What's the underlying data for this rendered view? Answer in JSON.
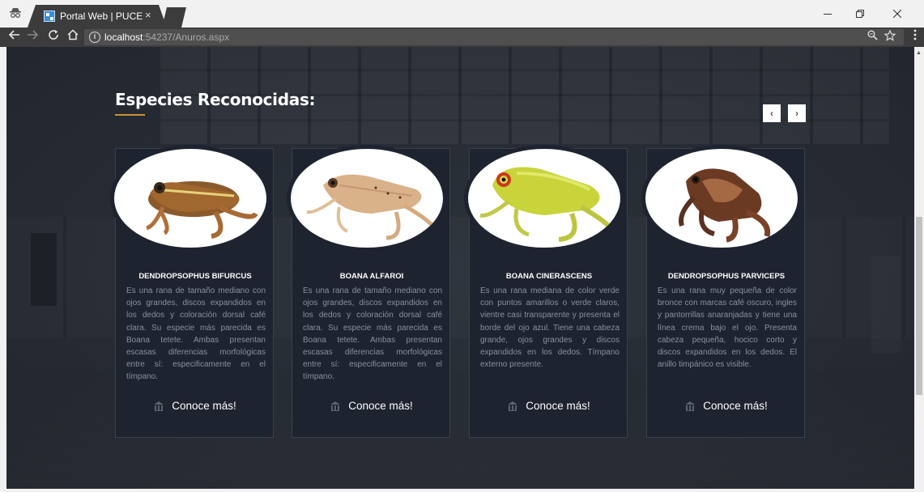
{
  "browser": {
    "tab_title": "Portal Web | PUCE",
    "tab_close": "×",
    "url_host": "localhost",
    "url_rest": ":54237/Anuros.aspx",
    "icons": [
      "incognito-icon",
      "back-icon",
      "forward-icon",
      "reload-icon",
      "home-icon",
      "info-icon",
      "zoom-icon",
      "star-icon",
      "menu-icon",
      "minimize-icon",
      "restore-icon",
      "close-window-icon"
    ]
  },
  "section": {
    "title": "Especies Reconocidas:",
    "prev": "‹",
    "next": "›",
    "accent_color": "#c8922f"
  },
  "cards": [
    {
      "name": "DENDROPSOPHUS BIFURCUS",
      "description": "Es una rana de tamaño mediano con ojos grandes, discos expandidos en los dedos y coloración dorsal café clara. Su especie más parecida es Boana tetete. Ambas presentan escasas diferencias morfológicas entre sí: especificamente en el tímpano.",
      "link": "Conoce más!"
    },
    {
      "name": "BOANA ALFAROI",
      "description": "Es una rana de tamaño mediano con ojos grandes, discos expandidos en los dedos y coloración dorsal café clara. Su especie más parecida es Boana tetete. Ambas presentan escasas diferencias morfológicas entre sí: especificamente en el tímpano.",
      "link": "Conoce más!"
    },
    {
      "name": "BOANA CINERASCENS",
      "description": "Es una rana mediana de color verde con puntos amarillos o verde claros, vientre casi transparente y presenta el borde del ojo azul. Tiene una cabeza grande, ojos grandes y discos expandidos en los dedos. Tímpano externo presente.",
      "link": "Conoce más!"
    },
    {
      "name": "DENDROPSOPHUS PARVICEPS",
      "description": "Es una rana muy pequeña de color bronce con marcas café oscuro, ingles y pantorrillas anaranjadas y tiene una línea crema bajo el ojo. Presenta cabeza pequeña, hocico corto y discos expandidos en los dedos. El anillo timpánico es visible.",
      "link": "Conoce más!"
    }
  ]
}
